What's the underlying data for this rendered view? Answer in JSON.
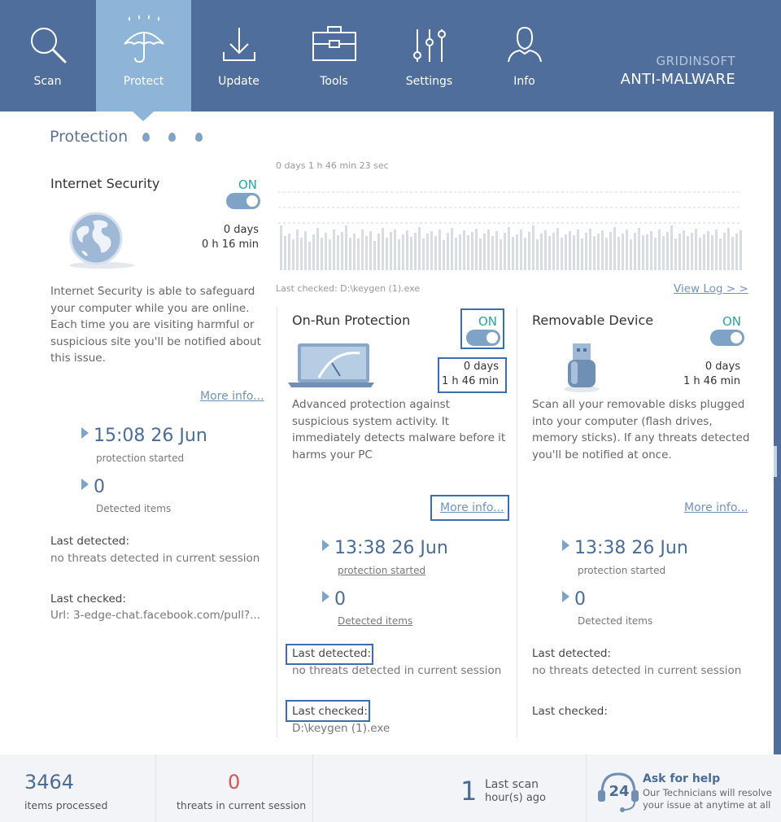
{
  "nav": {
    "items": [
      {
        "label": "Scan",
        "icon": "magnifier-icon"
      },
      {
        "label": "Protect",
        "icon": "umbrella-icon",
        "active": true
      },
      {
        "label": "Update",
        "icon": "download-icon"
      },
      {
        "label": "Tools",
        "icon": "toolbox-icon"
      },
      {
        "label": "Settings",
        "icon": "sliders-icon"
      },
      {
        "label": "Info",
        "icon": "person-icon"
      }
    ],
    "brand_top": "GRIDINSOFT",
    "brand_main": "ANTI-MALWARE"
  },
  "protection": {
    "title": "Protection"
  },
  "chart": {
    "elapsed": "0 days 1 h 46 min 23 sec",
    "last_checked": "Last checked: D:\\keygen (1).exe",
    "view_log": "View Log > >",
    "activity": [
      0.55,
      0.42,
      0.45,
      0.38,
      0.5,
      0.4,
      0.48,
      0.35,
      0.44,
      0.52,
      0.4,
      0.46,
      0.38,
      0.5,
      0.43,
      0.47,
      0.55,
      0.4,
      0.45,
      0.39,
      0.5,
      0.42,
      0.48,
      0.36,
      0.45,
      0.52,
      0.4,
      0.47,
      0.5,
      0.38,
      0.44,
      0.49,
      0.41,
      0.46,
      0.53,
      0.39,
      0.45,
      0.48,
      0.42,
      0.5,
      0.37,
      0.46,
      0.52,
      0.4,
      0.44,
      0.49,
      0.43,
      0.47,
      0.51,
      0.39,
      0.45,
      0.5,
      0.42,
      0.48,
      0.38,
      0.46,
      0.53,
      0.41,
      0.44,
      0.5,
      0.4,
      0.47,
      0.55,
      0.38,
      0.45,
      0.49,
      0.42,
      0.46,
      0.52,
      0.4,
      0.44,
      0.48,
      0.43,
      0.5,
      0.39,
      0.46,
      0.51,
      0.42,
      0.45,
      0.49,
      0.4,
      0.47,
      0.53,
      0.41,
      0.45,
      0.5,
      0.38,
      0.46,
      0.52,
      0.43,
      0.44,
      0.48,
      0.4,
      0.5,
      0.42,
      0.47,
      0.55,
      0.39,
      0.45,
      0.49,
      0.42,
      0.46,
      0.51,
      0.4,
      0.44,
      0.48,
      0.43,
      0.5,
      0.39,
      0.46,
      0.52,
      0.41,
      0.45,
      0.49
    ]
  },
  "internet": {
    "title": "Internet Security",
    "status": "ON",
    "days": "0 days",
    "time": "0 h 16 min",
    "desc": [
      "Internet Security is able to safeguard",
      "your computer while you are online.",
      "Each time you are visiting harmful or",
      "suspicious site you'll  be notified about",
      "this issue."
    ],
    "more": "More info...",
    "started_value": "15:08 26 Jun",
    "started_label": "protection started",
    "detected_value": "0",
    "detected_label": "Detected items",
    "last_detected_label": "Last detected:",
    "last_detected_value": "no threats detected in current session",
    "last_checked_label": "Last checked:",
    "last_checked_value": "Url: 3-edge-chat.facebook.com/pull?..."
  },
  "onrun": {
    "title": "On-Run Protection",
    "status": "ON",
    "days": "0 days",
    "time": "1 h 46 min",
    "desc": [
      "Advanced protection against",
      "suspicious system activity. It",
      "immediately detects malware before it",
      "harms your PC"
    ],
    "more": "More info...",
    "started_value": "13:38 26 Jun",
    "started_label": "protection started",
    "detected_value": "0",
    "detected_label": "Detected items",
    "last_detected_label": "Last detected:",
    "last_detected_value": "no threats detected in current session",
    "last_checked_label": "Last checked:",
    "last_checked_value": "D:\\keygen (1).exe"
  },
  "removable": {
    "title": "Removable Device",
    "status": "ON",
    "days": "0 days",
    "time": "1 h 46 min",
    "desc": [
      "Scan all your removable disks plugged",
      "into your computer (flash drives,",
      "memory sticks). If any threats detected",
      "you'll be notified at once."
    ],
    "more": "More info...",
    "started_value": "13:38 26 Jun",
    "started_label": "protection started",
    "detected_value": "0",
    "detected_label": "Detected items",
    "last_detected_label": "Last detected:",
    "last_detected_value": "no threats detected in current session",
    "last_checked_label": "Last checked:"
  },
  "footer": {
    "items_value": "3464",
    "items_label": "items processed",
    "threats_value": "0",
    "threats_label": "threats in current session",
    "scan_value": "1",
    "scan_label1": "Last scan",
    "scan_label2": "hour(s) ago",
    "help_badge": "24",
    "help_title": "Ask for help",
    "help_line1": "Our Technicians will resolve",
    "help_line2": "your issue at anytime at all"
  },
  "colors": {
    "header": "#4f6e9b",
    "active_tab": "#8eb4d8",
    "on_status": "#27a7a1",
    "threat_count": "#d9534f",
    "highlight": "#3b6eb0"
  }
}
